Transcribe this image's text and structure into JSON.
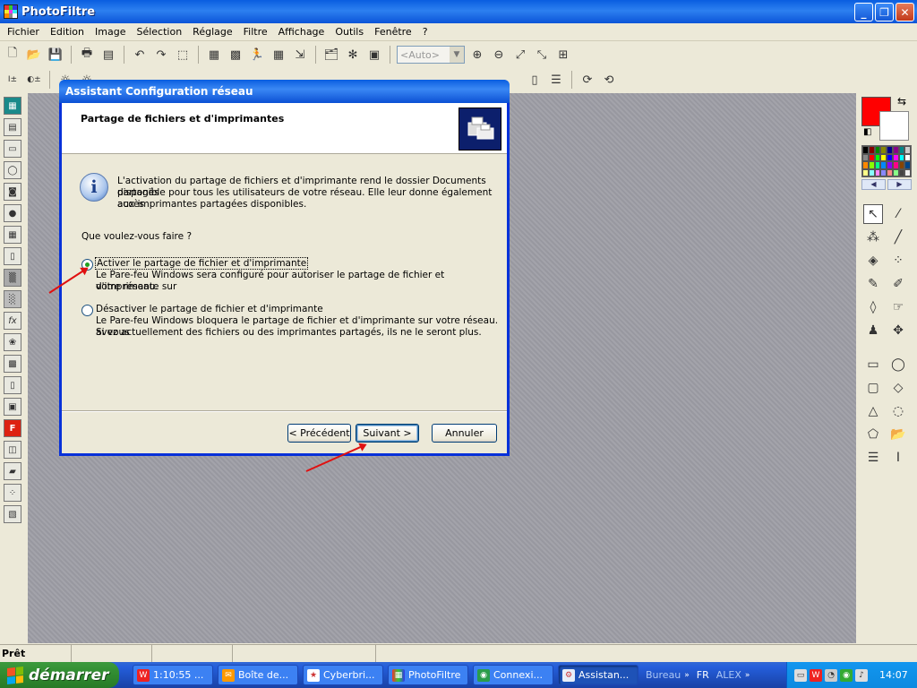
{
  "app": {
    "title": "PhotoFiltre"
  },
  "menu": [
    "Fichier",
    "Edition",
    "Image",
    "Sélection",
    "Réglage",
    "Filtre",
    "Affichage",
    "Outils",
    "Fenêtre",
    "?"
  ],
  "toolbar": {
    "zoom_value": "<Auto>"
  },
  "status": {
    "text": "Prêt"
  },
  "dialog": {
    "title": "Assistant Configuration réseau",
    "heading": "Partage de fichiers et d'imprimantes",
    "intro_line1": "L'activation du partage de fichiers et d'imprimante rend le dossier Documents partagés",
    "intro_line2": "disponible pour tous les utilisateurs de votre réseau. Elle leur donne également accès",
    "intro_line3": "aux imprimantes partagées disponibles.",
    "question": "Que voulez-vous faire ?",
    "option1_label": "Activer le partage de fichier et d'imprimante",
    "option1_desc1": "Le Pare-feu Windows sera configuré pour autoriser le partage de fichier et d'imprimante sur",
    "option1_desc2": "votre réseau.",
    "option2_label": "Désactiver le partage de fichier et d'imprimante",
    "option2_desc1": "Le Pare-feu Windows bloquera le partage de fichier et d'imprimante sur votre réseau. Si vous",
    "option2_desc2": "avez actuellement des fichiers ou des imprimantes partagés, ils ne le seront plus.",
    "selected_option": 1,
    "btn_back": "< Précédent",
    "btn_next": "Suivant >",
    "btn_cancel": "Annuler"
  },
  "taskbar": {
    "start": "démarrer",
    "tasks": [
      {
        "label": "1:10:55 ...",
        "icon": "w-icon"
      },
      {
        "label": "Boîte de...",
        "icon": "mail-icon"
      },
      {
        "label": "Cyberbri...",
        "icon": "star-icon"
      },
      {
        "label": "PhotoFiltre",
        "icon": "photofiltre-icon"
      },
      {
        "label": "Connexi...",
        "icon": "network-icon"
      },
      {
        "label": "Assistan...",
        "icon": "wizard-icon"
      }
    ],
    "bureau": "Bureau",
    "lang": "FR",
    "user": "ALEX",
    "clock": "14:07"
  },
  "colors": {
    "foreground": "#ff0000",
    "background": "#ffffff",
    "xp_blue": "#0831d9"
  }
}
